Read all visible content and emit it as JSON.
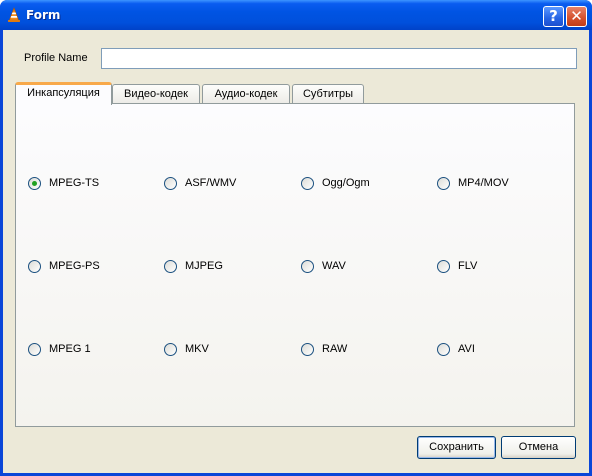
{
  "window": {
    "title": "Form"
  },
  "profile": {
    "label": "Profile Name",
    "value": "",
    "placeholder": ""
  },
  "tabs": [
    {
      "label": "Инкапсуляция",
      "active": true
    },
    {
      "label": "Видео-кодек",
      "active": false
    },
    {
      "label": "Аудио-кодек",
      "active": false
    },
    {
      "label": "Субтитры",
      "active": false
    }
  ],
  "encapsulation": {
    "selected": "MPEG-TS",
    "options": [
      [
        "MPEG-TS",
        "ASF/WMV",
        "Ogg/Ogm",
        "MP4/MOV"
      ],
      [
        "MPEG-PS",
        "MJPEG",
        "WAV",
        "FLV"
      ],
      [
        "MPEG 1",
        "MKV",
        "RAW",
        "AVI"
      ]
    ]
  },
  "buttons": {
    "save": "Сохранить",
    "cancel": "Отмена"
  },
  "colors": {
    "titlebar": "#0054e3",
    "client": "#ece9d8",
    "active_tab_accent": "#f8a94a",
    "radio_check": "#21a121"
  }
}
